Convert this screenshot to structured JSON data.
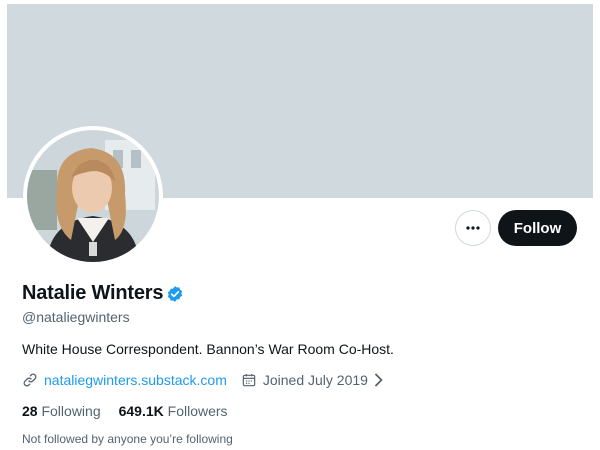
{
  "profile": {
    "name": "Natalie Winters",
    "handle": "@nataliegwinters",
    "bio": "White House Correspondent. Bannon’s War Room Co-Host.",
    "website": "nataliegwinters.substack.com",
    "joined": "Joined July 2019",
    "verified": true
  },
  "stats": {
    "following_count": "28",
    "following_label": "Following",
    "followers_count": "649.1K",
    "followers_label": "Followers"
  },
  "actions": {
    "follow_label": "Follow",
    "more_icon": "more-horizontal-icon"
  },
  "footer": {
    "not_followed": "Not followed by anyone you’re following"
  },
  "colors": {
    "banner": "#cfd9de",
    "accent": "#1d9bf0",
    "text": "#0f1419",
    "secondary": "#536471",
    "button": "#0f1419"
  }
}
